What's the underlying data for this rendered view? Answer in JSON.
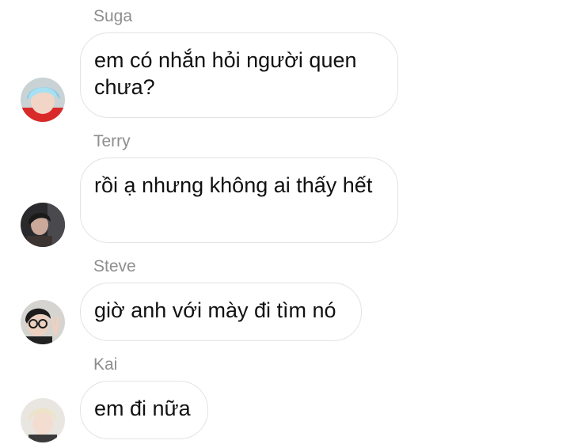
{
  "messages": [
    {
      "sender": "Suga",
      "text": "em có nhắn hỏi người quen chưa?",
      "avatar": "user-avatar-blue-hair"
    },
    {
      "sender": "Terry",
      "text": "rồi ạ nhưng không ai thấy hết",
      "avatar": "user-avatar-dark"
    },
    {
      "sender": "Steve",
      "text": "giờ anh với mày đi tìm nó",
      "avatar": "user-avatar-glasses"
    },
    {
      "sender": "Kai",
      "text": "em đi nữa",
      "avatar": "user-avatar-blonde"
    }
  ],
  "colors": {
    "sender_text": "#8e8e8e",
    "bubble_border": "#e3e3e3",
    "message_text": "#111111"
  }
}
